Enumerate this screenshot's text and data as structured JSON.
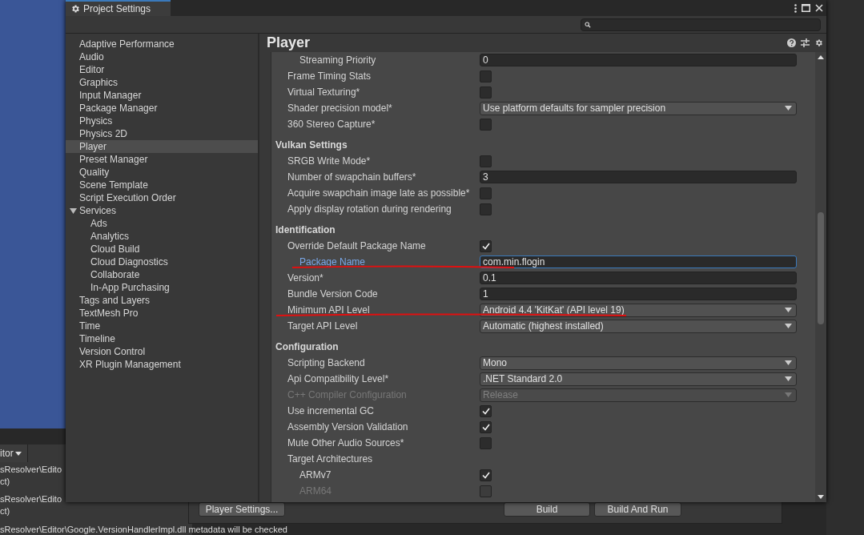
{
  "window": {
    "title": "Project Settings"
  },
  "sidebar": {
    "items": [
      {
        "label": "Adaptive Performance",
        "selected": false
      },
      {
        "label": "Audio",
        "selected": false
      },
      {
        "label": "Editor",
        "selected": false
      },
      {
        "label": "Graphics",
        "selected": false
      },
      {
        "label": "Input Manager",
        "selected": false
      },
      {
        "label": "Package Manager",
        "selected": false
      },
      {
        "label": "Physics",
        "selected": false
      },
      {
        "label": "Physics 2D",
        "selected": false
      },
      {
        "label": "Player",
        "selected": true
      },
      {
        "label": "Preset Manager",
        "selected": false
      },
      {
        "label": "Quality",
        "selected": false
      },
      {
        "label": "Scene Template",
        "selected": false
      },
      {
        "label": "Script Execution Order",
        "selected": false
      },
      {
        "label": "Services",
        "selected": false,
        "expanded": true,
        "children": [
          {
            "label": "Ads",
            "selected": false
          },
          {
            "label": "Analytics",
            "selected": false
          },
          {
            "label": "Cloud Build",
            "selected": false
          },
          {
            "label": "Cloud Diagnostics",
            "selected": false
          },
          {
            "label": "Collaborate",
            "selected": false
          },
          {
            "label": "In-App Purchasing",
            "selected": false
          }
        ]
      },
      {
        "label": "Tags and Layers",
        "selected": false
      },
      {
        "label": "TextMesh Pro",
        "selected": false
      },
      {
        "label": "Time",
        "selected": false
      },
      {
        "label": "Timeline",
        "selected": false
      },
      {
        "label": "Version Control",
        "selected": false
      },
      {
        "label": "XR Plugin Management",
        "selected": false
      }
    ]
  },
  "panel": {
    "title": "Player",
    "rows": [
      {
        "kind": "field",
        "label": "Streaming Priority",
        "value": "0",
        "nested": true
      },
      {
        "kind": "check",
        "label": "Frame Timing Stats",
        "checked": false
      },
      {
        "kind": "check",
        "label": "Virtual Texturing*",
        "checked": false
      },
      {
        "kind": "dropdown",
        "label": "Shader precision model*",
        "value": "Use platform defaults for sampler precision"
      },
      {
        "kind": "check",
        "label": "360 Stereo Capture*",
        "checked": false
      },
      {
        "kind": "header",
        "label": "Vulkan Settings"
      },
      {
        "kind": "check",
        "label": "SRGB Write Mode*",
        "checked": false
      },
      {
        "kind": "field",
        "label": "Number of swapchain buffers*",
        "value": "3"
      },
      {
        "kind": "check",
        "label": "Acquire swapchain image late as possible*",
        "checked": false
      },
      {
        "kind": "check",
        "label": "Apply display rotation during rendering",
        "checked": false
      },
      {
        "kind": "header",
        "label": "Identification"
      },
      {
        "kind": "check",
        "label": "Override Default Package Name",
        "checked": true,
        "children": [
          {
            "kind": "field",
            "label": "Package Name",
            "value": "com.min.flogin",
            "focused": true,
            "underlined": true
          }
        ]
      },
      {
        "kind": "field",
        "label": "Version*",
        "value": "0.1"
      },
      {
        "kind": "field",
        "label": "Bundle Version Code",
        "value": "1"
      },
      {
        "kind": "dropdown",
        "label": "Minimum API Level",
        "value": "Android 4.4 'KitKat' (API level 19)",
        "underlined": true
      },
      {
        "kind": "dropdown",
        "label": "Target API Level",
        "value": "Automatic (highest installed)"
      },
      {
        "kind": "header",
        "label": "Configuration"
      },
      {
        "kind": "dropdown",
        "label": "Scripting Backend",
        "value": "Mono"
      },
      {
        "kind": "dropdown",
        "label": "Api Compatibility Level*",
        "value": ".NET Standard 2.0"
      },
      {
        "kind": "dropdown",
        "label": "C++ Compiler Configuration",
        "value": "Release",
        "disabled": true
      },
      {
        "kind": "check",
        "label": "Use incremental GC",
        "checked": true
      },
      {
        "kind": "check",
        "label": "Assembly Version Validation",
        "checked": true
      },
      {
        "kind": "check",
        "label": "Mute Other Audio Sources*",
        "checked": false
      },
      {
        "kind": "label",
        "label": "Target Architectures",
        "children": [
          {
            "kind": "check",
            "label": "ARMv7",
            "checked": true
          },
          {
            "kind": "check",
            "label": "ARM64",
            "checked": false,
            "disabled": true
          }
        ]
      }
    ]
  },
  "background": {
    "console_tab": "itor",
    "console_lines": [
      "sResolver\\Edito",
      "ct)",
      "sResolver\\Edito",
      "ct)",
      "sResolver\\Editor\\Google.VersionHandlerImpl.dll metadata will be checked"
    ],
    "build_buttons": [
      "Player Settings...",
      "Build",
      "Build And Run"
    ]
  }
}
